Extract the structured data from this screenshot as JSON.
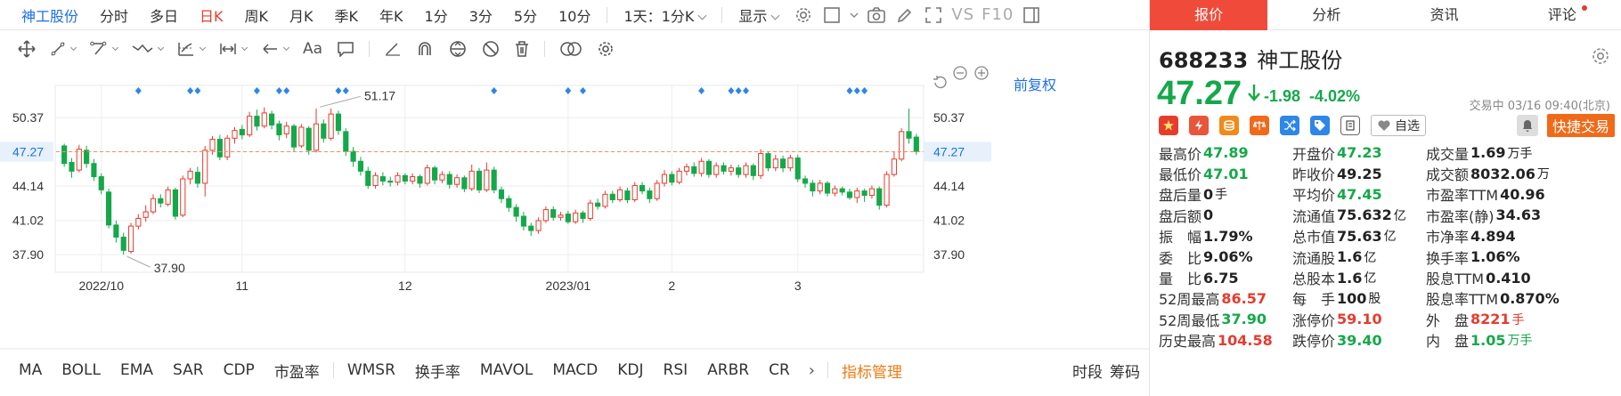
{
  "topbar": {
    "stock_name": "神工股份",
    "periods": [
      "分时",
      "多日",
      "日K",
      "周K",
      "月K",
      "季K",
      "年K",
      "1分",
      "3分",
      "5分",
      "10分"
    ],
    "active_period": "日K",
    "range_select": "1天：1分K",
    "display_select": "显示",
    "vs_label": "VS",
    "f10_label": "F10"
  },
  "toolbar": {
    "text_tool_label": "Aa"
  },
  "chart_data": {
    "type": "candlestick",
    "restore_label": "前复权",
    "y_ticks": [
      50.37,
      47.27,
      44.14,
      41.02,
      37.9
    ],
    "y_tick_labels": [
      "50.37",
      "47.27",
      "44.14",
      "41.02",
      "37.90"
    ],
    "ylim": [
      36.3,
      53.3
    ],
    "current_price": 47.27,
    "current_label": "47.27",
    "x_labels": [
      {
        "label": "2022/10",
        "index": 5
      },
      {
        "label": "11",
        "index": 24
      },
      {
        "label": "12",
        "index": 46
      },
      {
        "label": "2023/01",
        "index": 68
      },
      {
        "label": "2",
        "index": 82
      },
      {
        "label": "3",
        "index": 99
      }
    ],
    "annotations": [
      {
        "label": "51.17",
        "index": 34,
        "value": 51.17
      },
      {
        "label": "37.90",
        "index": 8,
        "value": 37.9
      }
    ],
    "event_marker_indices": [
      10,
      17,
      18,
      26,
      29,
      30,
      37,
      38,
      58,
      68,
      70,
      86,
      90,
      91,
      92,
      106,
      107,
      108
    ],
    "candles": [
      [
        47.8,
        46.2,
        48.0,
        45.9
      ],
      [
        46.3,
        45.5,
        46.7,
        44.9
      ],
      [
        45.6,
        47.5,
        47.9,
        45.4
      ],
      [
        47.4,
        46.2,
        47.8,
        45.8
      ],
      [
        46.2,
        45.0,
        46.6,
        44.6
      ],
      [
        45.0,
        43.8,
        45.3,
        43.4
      ],
      [
        43.6,
        40.6,
        43.9,
        40.3
      ],
      [
        40.6,
        39.5,
        41.0,
        39.0
      ],
      [
        39.5,
        38.3,
        39.9,
        37.9
      ],
      [
        38.2,
        40.5,
        40.8,
        38.0
      ],
      [
        40.5,
        41.2,
        41.6,
        40.2
      ],
      [
        41.3,
        41.8,
        42.4,
        40.9
      ],
      [
        41.8,
        43.0,
        43.4,
        41.6
      ],
      [
        43.0,
        42.6,
        43.4,
        42.2
      ],
      [
        42.5,
        43.8,
        44.1,
        42.3
      ],
      [
        43.8,
        41.4,
        44.0,
        41.1
      ],
      [
        41.5,
        44.8,
        45.1,
        41.3
      ],
      [
        44.8,
        45.5,
        45.8,
        44.3
      ],
      [
        45.4,
        44.4,
        45.9,
        44.0
      ],
      [
        44.4,
        47.4,
        47.8,
        43.2
      ],
      [
        47.4,
        48.4,
        48.7,
        47.0
      ],
      [
        48.4,
        46.8,
        48.8,
        46.5
      ],
      [
        46.8,
        48.5,
        48.8,
        46.5
      ],
      [
        48.5,
        49.2,
        49.5,
        48.0
      ],
      [
        49.3,
        48.8,
        49.7,
        48.4
      ],
      [
        48.8,
        50.5,
        50.9,
        48.6
      ],
      [
        50.5,
        49.6,
        51.1,
        49.2
      ],
      [
        49.6,
        50.8,
        51.3,
        49.4
      ],
      [
        50.7,
        49.7,
        51.0,
        49.3
      ],
      [
        49.8,
        48.8,
        50.1,
        48.3
      ],
      [
        48.9,
        49.6,
        50.0,
        48.5
      ],
      [
        49.6,
        47.7,
        49.8,
        47.3
      ],
      [
        47.8,
        49.5,
        49.8,
        47.6
      ],
      [
        49.4,
        47.4,
        49.6,
        47.0
      ],
      [
        47.4,
        49.8,
        51.2,
        47.2
      ],
      [
        49.8,
        48.5,
        50.2,
        48.1
      ],
      [
        48.5,
        50.7,
        51.2,
        48.3
      ],
      [
        50.7,
        49.2,
        51.0,
        48.8
      ],
      [
        49.1,
        47.3,
        49.4,
        46.9
      ],
      [
        47.3,
        46.4,
        47.7,
        45.9
      ],
      [
        46.4,
        45.5,
        46.8,
        45.1
      ],
      [
        45.5,
        44.2,
        45.9,
        43.9
      ],
      [
        44.2,
        45.1,
        45.4,
        43.9
      ],
      [
        45.0,
        44.6,
        45.4,
        44.2
      ],
      [
        44.6,
        44.5,
        45.0,
        44.1
      ],
      [
        44.5,
        45.1,
        45.4,
        44.2
      ],
      [
        45.1,
        44.6,
        45.3,
        44.3
      ],
      [
        44.6,
        45.0,
        45.3,
        44.3
      ],
      [
        45.0,
        44.4,
        45.2,
        44.0
      ],
      [
        44.4,
        45.8,
        46.1,
        44.2
      ],
      [
        45.8,
        44.7,
        46.0,
        44.3
      ],
      [
        44.7,
        45.2,
        45.5,
        44.4
      ],
      [
        45.2,
        44.3,
        45.5,
        43.9
      ],
      [
        44.3,
        44.9,
        45.2,
        44.0
      ],
      [
        44.9,
        43.9,
        45.1,
        43.6
      ],
      [
        43.9,
        45.5,
        46.1,
        43.7
      ],
      [
        45.5,
        43.8,
        45.8,
        43.5
      ],
      [
        43.8,
        45.6,
        46.3,
        43.6
      ],
      [
        45.6,
        43.8,
        45.9,
        43.5
      ],
      [
        43.8,
        43.0,
        44.1,
        42.6
      ],
      [
        43.0,
        42.2,
        43.3,
        41.8
      ],
      [
        42.2,
        41.4,
        42.5,
        40.9
      ],
      [
        41.4,
        40.5,
        41.8,
        40.1
      ],
      [
        40.5,
        40.1,
        40.8,
        39.6
      ],
      [
        40.1,
        41.0,
        41.3,
        39.8
      ],
      [
        41.0,
        42.0,
        42.3,
        40.8
      ],
      [
        42.0,
        41.3,
        42.3,
        41.0
      ],
      [
        41.3,
        41.5,
        41.8,
        41.0
      ],
      [
        41.6,
        40.9,
        41.9,
        40.7
      ],
      [
        40.9,
        41.7,
        42.0,
        40.7
      ],
      [
        41.7,
        41.2,
        41.9,
        40.8
      ],
      [
        41.2,
        42.6,
        42.9,
        41.0
      ],
      [
        42.6,
        42.3,
        43.0,
        42.0
      ],
      [
        42.3,
        43.4,
        43.7,
        42.1
      ],
      [
        43.4,
        42.9,
        43.7,
        42.6
      ],
      [
        42.9,
        43.8,
        44.1,
        42.7
      ],
      [
        43.7,
        42.9,
        44.0,
        42.6
      ],
      [
        42.9,
        44.2,
        44.5,
        42.7
      ],
      [
        44.2,
        43.7,
        44.5,
        43.4
      ],
      [
        43.7,
        43.0,
        44.0,
        42.6
      ],
      [
        43.0,
        44.4,
        44.7,
        42.8
      ],
      [
        44.4,
        45.2,
        45.6,
        44.1
      ],
      [
        45.2,
        44.5,
        45.5,
        44.2
      ],
      [
        44.5,
        45.5,
        45.8,
        44.3
      ],
      [
        45.5,
        45.9,
        46.2,
        45.1
      ],
      [
        45.9,
        45.3,
        46.3,
        45.0
      ],
      [
        45.3,
        46.4,
        46.7,
        45.0
      ],
      [
        46.4,
        45.2,
        46.6,
        44.9
      ],
      [
        45.2,
        46.0,
        46.3,
        44.9
      ],
      [
        46.0,
        45.5,
        46.3,
        45.2
      ],
      [
        45.5,
        45.8,
        46.1,
        45.1
      ],
      [
        45.8,
        45.2,
        46.1,
        44.9
      ],
      [
        45.2,
        46.0,
        46.3,
        44.9
      ],
      [
        46.0,
        45.1,
        46.2,
        44.7
      ],
      [
        45.1,
        47.1,
        47.5,
        44.8
      ],
      [
        47.1,
        45.8,
        47.3,
        45.5
      ],
      [
        45.8,
        46.6,
        47.0,
        45.5
      ],
      [
        46.6,
        45.8,
        46.9,
        45.4
      ],
      [
        45.8,
        46.7,
        47.0,
        45.5
      ],
      [
        46.7,
        44.8,
        47.0,
        44.5
      ],
      [
        44.8,
        44.4,
        45.1,
        44.0
      ],
      [
        44.4,
        43.7,
        44.7,
        43.2
      ],
      [
        43.7,
        44.4,
        44.7,
        43.4
      ],
      [
        44.4,
        43.5,
        44.6,
        43.2
      ],
      [
        43.5,
        43.9,
        44.2,
        43.2
      ],
      [
        43.9,
        43.6,
        44.1,
        43.3
      ],
      [
        43.6,
        43.1,
        43.9,
        42.9
      ],
      [
        43.1,
        43.7,
        44.0,
        42.6
      ],
      [
        43.7,
        43.3,
        43.9,
        42.7
      ],
      [
        43.3,
        43.9,
        44.2,
        43.0
      ],
      [
        43.9,
        42.4,
        44.1,
        42.0
      ],
      [
        42.4,
        45.2,
        45.5,
        42.2
      ],
      [
        45.2,
        46.6,
        47.3,
        45.0
      ],
      [
        46.6,
        49.1,
        49.4,
        46.4
      ],
      [
        49.1,
        48.5,
        51.2,
        48.0
      ],
      [
        48.6,
        47.3,
        48.9,
        47.0
      ]
    ]
  },
  "indicators": {
    "items": [
      "MA",
      "BOLL",
      "EMA",
      "SAR",
      "CDP",
      "市盈率",
      "WMSR",
      "换手率",
      "MAVOL",
      "MACD",
      "KDJ",
      "RSI",
      "ARBR",
      "CR"
    ],
    "more": "›",
    "manage": "指标管理",
    "right": [
      "时段",
      "筹码"
    ]
  },
  "panel": {
    "tabs": [
      "报价",
      "分析",
      "资讯",
      "评论"
    ],
    "code": "688233",
    "name": "神工股份",
    "price": "47.27",
    "change": "-1.98",
    "change_pct": "-4.02%",
    "status": "交易中 03/16 09:40(北京)",
    "watch_label": "自选",
    "quick_trade": "快捷交易",
    "colors": {
      "up": "#e53c2e",
      "down": "#15a84a",
      "accent": "#f04b3a",
      "link": "#1f6fe5"
    },
    "rows": [
      [
        {
          "l": "最高价",
          "v": "47.89",
          "c": "green"
        },
        {
          "l": "开盘价",
          "v": "47.23",
          "c": "green"
        },
        {
          "l": "成交量",
          "v": "1.69",
          "u": "万手",
          "c": ""
        }
      ],
      [
        {
          "l": "最低价",
          "v": "47.01",
          "c": "green"
        },
        {
          "l": "昨收价",
          "v": "49.25",
          "c": ""
        },
        {
          "l": "成交额",
          "v": "8032.06",
          "u": "万",
          "c": ""
        }
      ],
      [
        {
          "l": "盘后量",
          "v": "0",
          "u": "手",
          "c": ""
        },
        {
          "l": "平均价",
          "v": "47.45",
          "c": "green"
        },
        {
          "l": "市盈率TTM",
          "v": "40.96",
          "c": ""
        }
      ],
      [
        {
          "l": "盘后额",
          "v": "0",
          "c": ""
        },
        {
          "l": "流通值",
          "v": "75.632",
          "u": "亿",
          "c": ""
        },
        {
          "l": "市盈率(静)",
          "v": "34.63",
          "c": ""
        }
      ],
      [
        {
          "l": "振　幅",
          "v": "1.79%",
          "c": ""
        },
        {
          "l": "总市值",
          "v": "75.63",
          "u": "亿",
          "c": ""
        },
        {
          "l": "市净率",
          "v": "4.894",
          "c": ""
        }
      ],
      [
        {
          "l": "委　比",
          "v": "9.06%",
          "c": ""
        },
        {
          "l": "流通股",
          "v": "1.6",
          "u": "亿",
          "c": ""
        },
        {
          "l": "换手率",
          "v": "1.06%",
          "c": ""
        }
      ],
      [
        {
          "l": "量　比",
          "v": "6.75",
          "c": ""
        },
        {
          "l": "总股本",
          "v": "1.6",
          "u": "亿",
          "c": ""
        },
        {
          "l": "股息TTM",
          "v": "0.410",
          "c": ""
        }
      ],
      [
        {
          "l": "52周最高",
          "v": "86.57",
          "c": "red"
        },
        {
          "l": "每　手",
          "v": "100",
          "u": "股",
          "c": ""
        },
        {
          "l": "股息率TTM",
          "v": "0.870%",
          "c": ""
        }
      ],
      [
        {
          "l": "52周最低",
          "v": "37.90",
          "c": "green"
        },
        {
          "l": "涨停价",
          "v": "59.10",
          "c": "red"
        },
        {
          "l": "外　盘",
          "v": "8221",
          "u": "手",
          "c": "red"
        }
      ],
      [
        {
          "l": "历史最高",
          "v": "104.58",
          "c": "red"
        },
        {
          "l": "跌停价",
          "v": "39.40",
          "c": "green"
        },
        {
          "l": "内　盘",
          "v": "1.05",
          "u": "万手",
          "c": "green"
        }
      ]
    ]
  }
}
